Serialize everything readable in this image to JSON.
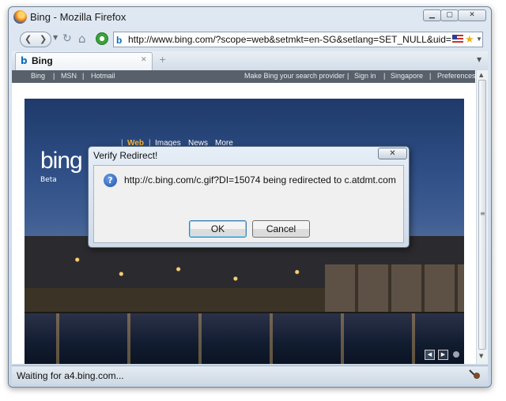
{
  "window": {
    "title": "Bing - Mozilla Firefox",
    "minimize_label": "▁",
    "maximize_label": "▢",
    "close_label": "✕"
  },
  "navbar": {
    "back_label": "❮",
    "forward_label": "❯",
    "url": "http://www.bing.com/?scope=web&setmkt=en-SG&setlang=SET_NULL&uid=",
    "url_favicon": "b"
  },
  "tab": {
    "label": "Bing",
    "favicon": "b",
    "close_label": "✕",
    "newtab_label": "+"
  },
  "bing": {
    "topnav_left": [
      "Bing",
      "|",
      "MSN",
      "|",
      "Hotmail"
    ],
    "topnav_right": [
      "Make Bing your search provider",
      "|",
      "Sign in",
      "|",
      "Singapore",
      "|",
      "Preferences"
    ],
    "logo": "bing",
    "beta": "Beta",
    "scopes": [
      "Web",
      "Images",
      "News",
      "More"
    ],
    "hero_prev_label": "◀",
    "hero_next_label": "▶"
  },
  "dialog": {
    "title": "Verify Redirect!",
    "close_label": "✕",
    "icon_glyph": "?",
    "message": "http://c.bing.com/c.gif?DI=15074 being redirected to c.atdmt.com",
    "ok_label": "OK",
    "cancel_label": "Cancel"
  },
  "status": {
    "text": "Waiting for a4.bing.com..."
  },
  "icons": {
    "firefox": "firefox-icon",
    "reload": "reload-icon",
    "home": "home-icon",
    "star": "bookmark-star-icon",
    "question": "question-icon"
  }
}
